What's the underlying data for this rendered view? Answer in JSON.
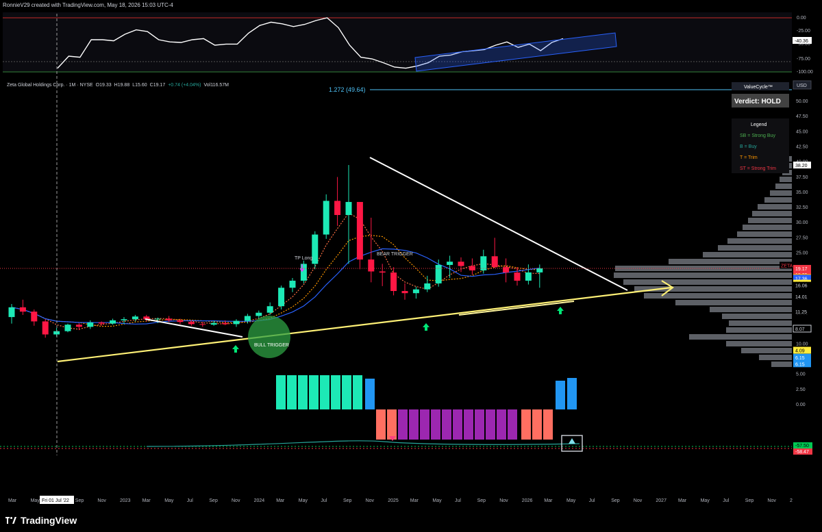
{
  "header": {
    "attribution": "RonnieV29 created with TradingView.com, May 18, 2026 15:03 UTC-4"
  },
  "symbol_line": {
    "name": "Zeta Global Holdings Corp. · 1M · NYSE",
    "open": "O19.33",
    "high": "H19.88",
    "low": "L15.60",
    "close": "C19.17",
    "change": "+0.74 (+4.04%)",
    "volume": "Vol116.57M"
  },
  "indicator_panel": {
    "yticks": [
      "0.00",
      "-25.00",
      "-50.00",
      "-75.00",
      "-100.00"
    ],
    "last_value": "-40.36"
  },
  "fib_label": "1.272 (49.64)",
  "currency": "USD",
  "valuecycle": {
    "title": "ValueCycle™",
    "verdict": "Verdict: HOLD",
    "legend_title": "Legend",
    "items": [
      {
        "text": "SB = Strong Buy",
        "color": "#4caf50"
      },
      {
        "text": "B = Buy",
        "color": "#26a69a"
      },
      {
        "text": "T = Trim",
        "color": "#ff9800"
      },
      {
        "text": "ST = Strong Trim",
        "color": "#f23645"
      }
    ]
  },
  "annotations": {
    "tp_long": "TP Long",
    "bear_trigger": "BEAR TRIGGER",
    "bull_trigger": "BULL TRIGGER"
  },
  "price_tags": [
    {
      "text": "38.20",
      "value": 38.2,
      "bg": "#ffffff",
      "fg": "#000000"
    },
    {
      "text": "ZETA",
      "value": 19.75,
      "bg": "#000000",
      "fg": "#f23645",
      "left": true
    },
    {
      "text": "19.17",
      "value": 19.17,
      "bg": "#f23645",
      "fg": "#ffffff"
    },
    {
      "text": "18.05",
      "value": 18.05,
      "bg": "#f23645",
      "fg": "#ffffff"
    },
    {
      "text": "17.53",
      "value": 17.53,
      "bg": "#ff9800",
      "fg": "#000000"
    },
    {
      "text": "17.36",
      "value": 17.36,
      "bg": "#2962ff",
      "fg": "#ffffff"
    },
    {
      "text": "16.44",
      "value": 16.44,
      "bg": "#ffeb3b",
      "fg": "#000000"
    },
    {
      "text": "16.06",
      "value": 16.06,
      "bg": "#000000",
      "fg": "#d1d4dc"
    },
    {
      "text": "14.01",
      "value": 14.01,
      "bg": "#000000",
      "fg": "#d1d4dc"
    },
    {
      "text": "11.25",
      "value": 11.25,
      "bg": "#000000",
      "fg": "#d1d4dc"
    },
    {
      "text": "8.07",
      "value": 8.07,
      "bg": "#000000",
      "fg": "#d1d4dc",
      "boxed": true
    },
    {
      "text": "4.09",
      "value": 4.09,
      "bg": "#ffeb3b",
      "fg": "#000000"
    },
    {
      "text": "6.15",
      "value": 2.8,
      "bg": "#2196f3",
      "fg": "#ffffff"
    },
    {
      "text": "6.15",
      "value": 1.6,
      "bg": "#2196f3",
      "fg": "#ffffff"
    }
  ],
  "bottom_tags": [
    {
      "text": "-57.50",
      "bg": "#00c853",
      "fg": "#000000"
    },
    {
      "text": "-58.47",
      "bg": "#f23645",
      "fg": "#ffffff"
    }
  ],
  "x_axis": {
    "labels": [
      "Mar",
      "May",
      "Fri 01 Jul '22",
      "Sep",
      "Nov",
      "2023",
      "Mar",
      "May",
      "Jul",
      "Sep",
      "Nov",
      "2024",
      "Mar",
      "May",
      "Jul",
      "Sep",
      "Nov",
      "2025",
      "Mar",
      "May",
      "Jul",
      "Sep",
      "Nov",
      "2026",
      "Mar",
      "May",
      "Jul",
      "Sep",
      "Nov",
      "2027",
      "Mar",
      "May",
      "Jul",
      "Sep",
      "Nov",
      "2"
    ],
    "highlighted": "Fri 01 Jul '22"
  },
  "brand": "TradingView",
  "chart_data": {
    "type": "candlestick",
    "title": "Zeta Global Holdings Corp. · 1M · NYSE",
    "currency": "USD",
    "y_axis": {
      "ticks": [
        "50.00",
        "47.50",
        "45.00",
        "42.50",
        "40.00",
        "37.50",
        "35.00",
        "32.50",
        "30.00",
        "27.50",
        "25.00",
        "22.50",
        "20.00",
        "17.50",
        "15.00",
        "12.50",
        "10.00",
        "7.50",
        "5.00",
        "2.50",
        "0.00"
      ],
      "scale": "log"
    },
    "candles_monthly_from_2022_03": [
      [
        10.2,
        12.6,
        9.0,
        12.0
      ],
      [
        12.0,
        13.4,
        10.6,
        11.2
      ],
      [
        11.2,
        11.6,
        8.6,
        9.4
      ],
      [
        9.4,
        9.8,
        6.4,
        7.0
      ],
      [
        7.0,
        8.2,
        6.6,
        7.6
      ],
      [
        7.6,
        9.0,
        7.4,
        8.8
      ],
      [
        8.8,
        9.1,
        7.8,
        8.4
      ],
      [
        8.4,
        9.6,
        8.0,
        9.2
      ],
      [
        9.2,
        9.4,
        8.6,
        9.0
      ],
      [
        9.0,
        9.9,
        8.8,
        9.6
      ],
      [
        9.6,
        10.2,
        8.9,
        9.8
      ],
      [
        9.8,
        10.6,
        9.4,
        10.3
      ],
      [
        10.3,
        10.6,
        9.4,
        9.8
      ],
      [
        9.8,
        10.1,
        9.1,
        9.9
      ],
      [
        9.9,
        10.4,
        9.3,
        9.6
      ],
      [
        9.6,
        9.9,
        8.9,
        9.3
      ],
      [
        9.3,
        9.6,
        8.6,
        8.9
      ],
      [
        8.9,
        9.3,
        8.4,
        8.8
      ],
      [
        8.8,
        9.5,
        8.6,
        9.1
      ],
      [
        9.1,
        9.6,
        8.7,
        8.9
      ],
      [
        8.9,
        9.8,
        8.4,
        9.5
      ],
      [
        9.5,
        10.8,
        9.0,
        10.4
      ],
      [
        10.4,
        11.4,
        10.0,
        11.0
      ],
      [
        11.0,
        12.9,
        10.6,
        12.2
      ],
      [
        12.2,
        16.0,
        11.6,
        15.6
      ],
      [
        15.6,
        17.4,
        14.8,
        16.9
      ],
      [
        16.9,
        20.6,
        16.4,
        20.0
      ],
      [
        20.0,
        26.0,
        19.0,
        25.4
      ],
      [
        25.4,
        32.8,
        24.6,
        31.6
      ],
      [
        31.6,
        36.0,
        27.0,
        29.0
      ],
      [
        29.0,
        38.2,
        20.0,
        31.4
      ],
      [
        31.4,
        30.4,
        19.0,
        20.8
      ],
      [
        20.8,
        28.5,
        16.6,
        18.6
      ],
      [
        18.6,
        20.0,
        15.9,
        18.4
      ],
      [
        18.4,
        19.4,
        14.2,
        15.0
      ],
      [
        15.0,
        16.4,
        13.4,
        14.6
      ],
      [
        14.6,
        15.8,
        13.6,
        15.3
      ],
      [
        15.3,
        17.8,
        14.8,
        16.4
      ],
      [
        16.4,
        20.8,
        15.8,
        19.8
      ],
      [
        19.8,
        21.5,
        17.4,
        20.4
      ],
      [
        20.4,
        21.2,
        18.5,
        19.6
      ],
      [
        19.6,
        21.0,
        18.0,
        18.8
      ],
      [
        18.8,
        22.6,
        18.2,
        21.4
      ],
      [
        21.4,
        24.8,
        19.2,
        19.4
      ],
      [
        19.4,
        21.0,
        16.6,
        18.4
      ],
      [
        18.4,
        19.4,
        16.0,
        16.9
      ],
      [
        16.9,
        19.9,
        16.2,
        18.42
      ],
      [
        18.42,
        19.88,
        15.6,
        19.17
      ]
    ],
    "trendline_upper_from_high": 38.2,
    "fib_extension": {
      "label": "1.272",
      "value": 49.64
    },
    "volume_profile": true
  }
}
